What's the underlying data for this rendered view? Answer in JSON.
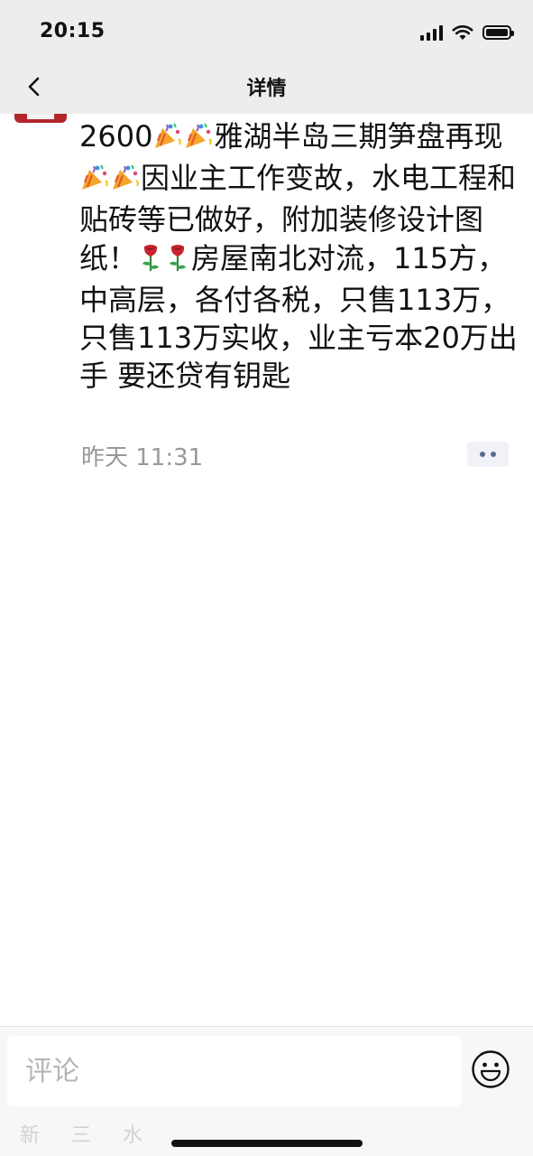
{
  "status_bar": {
    "time": "20:15",
    "icons": [
      "signal-icon",
      "wifi-icon",
      "battery-icon"
    ]
  },
  "nav": {
    "back_icon": "chevron-left-icon",
    "title": "详情"
  },
  "post": {
    "segments": [
      {
        "type": "text",
        "value": "2600"
      },
      {
        "type": "emoji",
        "name": "party-popper-icon"
      },
      {
        "type": "emoji",
        "name": "party-popper-icon"
      },
      {
        "type": "text",
        "value": "雅湖半岛三期笋盘再现"
      },
      {
        "type": "emoji",
        "name": "party-popper-icon"
      },
      {
        "type": "emoji",
        "name": "party-popper-icon"
      },
      {
        "type": "text",
        "value": "因业主工作变故，水电工程和贴砖等已做好，附加装修设计图纸！"
      },
      {
        "type": "emoji",
        "name": "rose-icon"
      },
      {
        "type": "emoji",
        "name": "rose-icon"
      },
      {
        "type": "text",
        "value": "房屋南北对流，115方，中高层，各付各税，只售113万，只售113万实收，业主亏本20万出手 要还贷有钥匙"
      }
    ],
    "timestamp": "昨天 11:31"
  },
  "comment": {
    "placeholder": "评论",
    "value": ""
  },
  "watermark": "新 三 水",
  "colors": {
    "bar_background": "#ededed",
    "link_blue": "#576b95",
    "timestamp_gray": "#999999",
    "avatar_red": "#b3262c"
  }
}
